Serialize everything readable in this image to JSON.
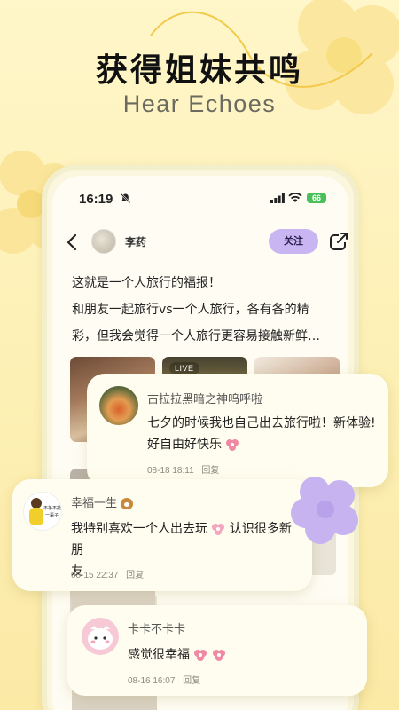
{
  "headline": "获得姐妹共鸣",
  "subheadline": "Hear Echoes",
  "status_bar": {
    "time": "16:19",
    "battery": "66"
  },
  "post_nav": {
    "username": "李药",
    "follow_label": "关注"
  },
  "post": {
    "lines": [
      "这就是一个人旅行的福报！",
      "和朋友一起旅行vs一个人旅行，各有各的精",
      "彩，但我会觉得一个人旅行更容易接触新鲜…"
    ],
    "live_label": "LIVE"
  },
  "comments": [
    {
      "name": "古拉拉黑暗之神呜呼啦",
      "text_line1": "七夕的时候我也自己出去旅行啦！新体验!",
      "text_line2": "好自由好快乐",
      "date": "08-18 18:11",
      "reply_label": "回复"
    },
    {
      "name": "幸福一生",
      "text_line1": "我特别喜欢一个人出去玩",
      "text_line1b": "认识很多新朋",
      "text_line2": "友",
      "date": "08-15 22:37",
      "reply_label": "回复",
      "avatar_caption1": "不争不抢",
      "avatar_caption2": "一辈子"
    },
    {
      "name": "卡卡不卡卡",
      "text_line1": "感觉很幸福",
      "date": "08-16 16:07",
      "reply_label": "回复"
    }
  ],
  "colors": {
    "background": "#fff6c9",
    "follow_button": "#c9b5f2",
    "purple_flower": "#c7b3f0",
    "yellow_flower": "#fbe38a"
  },
  "icons": [
    "bell-mute-icon",
    "signal-icon",
    "wifi-icon",
    "back-arrow-icon",
    "share-icon",
    "flower-emoji-icon",
    "dog-emoji-icon"
  ]
}
